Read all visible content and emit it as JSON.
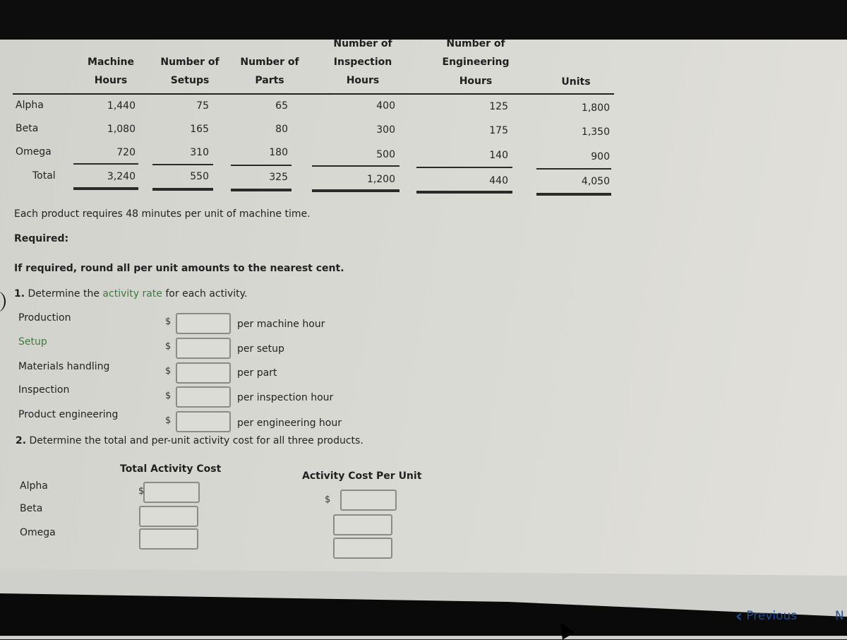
{
  "table": {
    "headers": [
      [
        "",
        "Machine",
        "Hours"
      ],
      [
        "",
        "Number of",
        "Setups"
      ],
      [
        "",
        "Number of",
        "Parts"
      ],
      [
        "Number of",
        "Inspection",
        "Hours"
      ],
      [
        "Number of",
        "Engineering",
        "Hours"
      ],
      [
        "",
        "",
        "Units"
      ]
    ],
    "rows": [
      {
        "label": "Alpha",
        "values": [
          "1,440",
          "75",
          "65",
          "400",
          "125",
          "1,800"
        ]
      },
      {
        "label": "Beta",
        "values": [
          "1,080",
          "165",
          "80",
          "300",
          "175",
          "1,350"
        ]
      },
      {
        "label": "Omega",
        "values": [
          "720",
          "310",
          "180",
          "500",
          "140",
          "900"
        ]
      },
      {
        "label": "Total",
        "values": [
          "3,240",
          "550",
          "325",
          "1,200",
          "440",
          "4,050"
        ]
      }
    ]
  },
  "note": "Each product requires 48 minutes per unit of machine time.",
  "required_label": "Required:",
  "rounding_instruction": "If required, round all per unit amounts to the nearest cent.",
  "question1": {
    "number": "1.",
    "prefix": "Determine the",
    "link": "activity rate",
    "suffix": "for each activity.",
    "rows": [
      {
        "label": "Production",
        "currency": "$",
        "value": "",
        "unit": "per machine hour",
        "highlight": false
      },
      {
        "label": "Setup",
        "currency": "$",
        "value": "",
        "unit": "per setup",
        "highlight": true
      },
      {
        "label": "Materials handling",
        "currency": "$",
        "value": "",
        "unit": "per part",
        "highlight": false
      },
      {
        "label": "Inspection",
        "currency": "$",
        "value": "",
        "unit": "per inspection hour",
        "highlight": false
      },
      {
        "label": "Product engineering",
        "currency": "$",
        "value": "",
        "unit": "per engineering hour",
        "highlight": false
      }
    ]
  },
  "question2": {
    "number": "2.",
    "text": "Determine the total and per-unit activity cost for all three products.",
    "col_total": "Total Activity Cost",
    "col_per_unit": "Activity Cost Per Unit",
    "currency": "$",
    "rows": [
      {
        "label": "Alpha",
        "total": "",
        "per_unit": ""
      },
      {
        "label": "Beta",
        "total": "",
        "per_unit": ""
      },
      {
        "label": "Omega",
        "total": "",
        "per_unit": ""
      }
    ]
  },
  "nav": {
    "previous": "Previous",
    "next": "N"
  },
  "colors": {
    "link_green": "#3d7a3d",
    "nav_blue": "#1f4d8f"
  }
}
